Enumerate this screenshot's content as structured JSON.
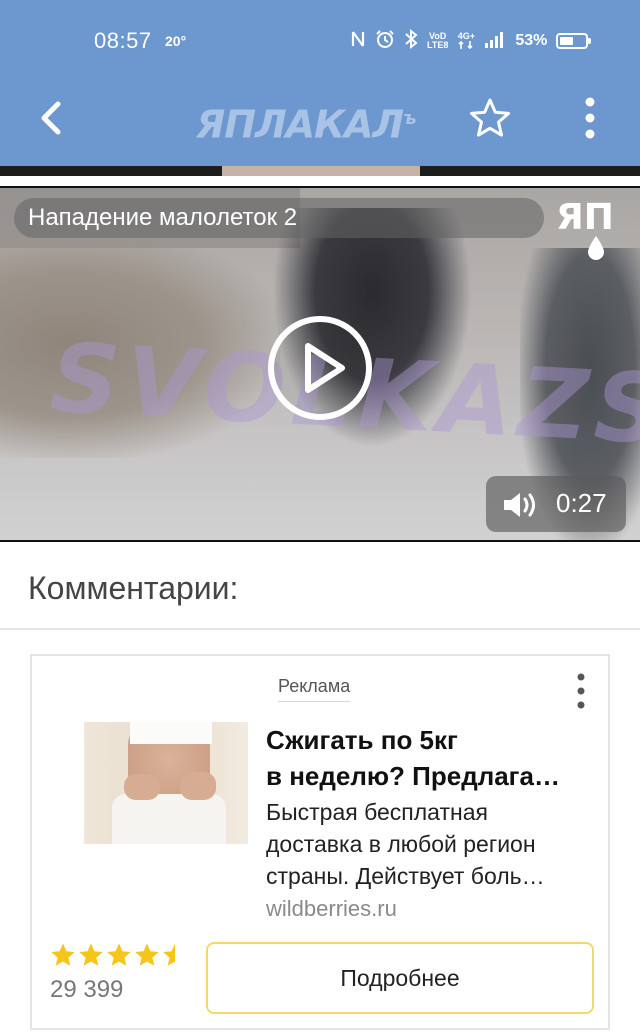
{
  "status_bar": {
    "time": "08:57",
    "temperature": "20°",
    "battery_percent": "53%",
    "battery_level": 0.53,
    "icons": [
      "nfc-icon",
      "alarm-icon",
      "bluetooth-icon",
      "volte-icon",
      "4g-icon",
      "signal-icon",
      "battery-icon"
    ],
    "volte_label_top": "VoD",
    "volte_label_bottom": "LTE8",
    "network_label": "4G+"
  },
  "app_bar": {
    "logo_text": "ЯПЛАКАЛ",
    "logo_sup": "ъ",
    "background": "#6d97cf"
  },
  "video": {
    "title": "Нападение малолеток 2",
    "brand_mark": "ЯП",
    "watermark": "SVOLKAZS",
    "duration": "0:27"
  },
  "comments": {
    "heading": "Комментарии:"
  },
  "ad": {
    "label": "Реклама",
    "title_line1": "Сжигать по 5кг",
    "title_line2": "в неделю? Предлага…",
    "desc_line1": "Быстрая бесплатная",
    "desc_line2": "доставка в любой регион",
    "desc_line3": "страны. Действует боль…",
    "domain": "wildberries.ru",
    "rating": 4.5,
    "rating_count": "29 399",
    "button_label": "Подробнее",
    "star_color": "#f5c518",
    "button_border": "#f1d96a"
  }
}
